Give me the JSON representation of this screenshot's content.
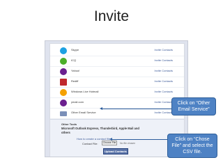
{
  "slide": {
    "title": "Invite"
  },
  "services": [
    {
      "name": "Skype",
      "action": "Invite Contacts",
      "icon": "skype-icon",
      "color": "#1da1e2"
    },
    {
      "name": "ICQ",
      "action": "Invite Contacts",
      "icon": "icq-flower-icon",
      "color": "#4caf2a"
    },
    {
      "name": "Yahoo!",
      "action": "Invite Contacts",
      "icon": "yahoo-icon",
      "color": "#6b1f8f"
    },
    {
      "name": "Rediff",
      "action": "Invite Contacts",
      "icon": "rediff-icon",
      "color": "#c0282d"
    },
    {
      "name": "Windows Live Hotmail",
      "action": "Invite Contacts",
      "icon": "windows-live-icon",
      "color": "#f4a100"
    },
    {
      "name": "ymail.com",
      "action": "Invite Contacts",
      "icon": "yahoo-icon",
      "color": "#6b1f8f"
    },
    {
      "name": "Other Email Service",
      "action": "Invite Contacts",
      "icon": "envelope-icon",
      "color": "#7a8fb8"
    }
  ],
  "other_tools": {
    "title": "Other Tools",
    "body": "Microsoft Outlook Express, Thunderbird, Apple Mail and others",
    "link": "How to create a contact file...",
    "file_label": "Contact File:",
    "choose_file": "Choose File",
    "file_status": "No file chosen",
    "upload": "Upload Contacts"
  },
  "callouts": {
    "other_email": "Click on “Other Email Service”",
    "choose_file": "Click on “Chose File” and select the CSV file."
  }
}
